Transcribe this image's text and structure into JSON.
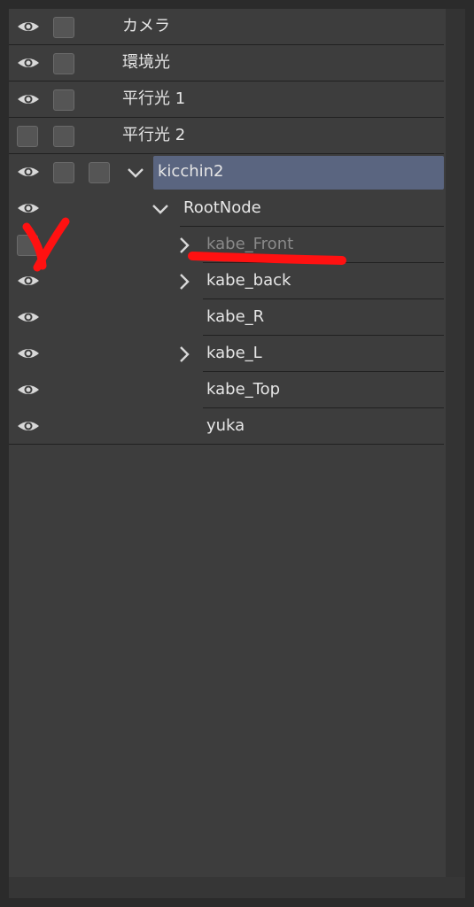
{
  "layer_panel": {
    "rows": [
      {
        "label": "カメラ",
        "visible": true,
        "checks": 1,
        "chevron": "none"
      },
      {
        "label": "環境光",
        "visible": true,
        "checks": 1,
        "chevron": "none"
      },
      {
        "label": "平行光 1",
        "visible": true,
        "checks": 1,
        "chevron": "none"
      },
      {
        "label": "平行光 2",
        "visible": false,
        "checks": 1,
        "chevron": "none"
      },
      {
        "label": "kicchin2",
        "visible": true,
        "checks": 2,
        "chevron": "down",
        "selected": true
      },
      {
        "label": "RootNode",
        "visible": true,
        "checks": 0,
        "chevron": "down"
      },
      {
        "label": "kabe_Front",
        "visible": false,
        "checks": 0,
        "chevron": "right",
        "dimmed": true
      },
      {
        "label": "kabe_back",
        "visible": true,
        "checks": 0,
        "chevron": "right"
      },
      {
        "label": "kabe_R",
        "visible": true,
        "checks": 0,
        "chevron": "none"
      },
      {
        "label": "kabe_L",
        "visible": true,
        "checks": 0,
        "chevron": "right"
      },
      {
        "label": "kabe_Top",
        "visible": true,
        "checks": 0,
        "chevron": "none"
      },
      {
        "label": "yuka",
        "visible": true,
        "checks": 0,
        "chevron": "none"
      }
    ]
  },
  "colors": {
    "panel_bg": "#3d3d3d",
    "selection": "#5a6580",
    "annotation": "#ff1111"
  }
}
